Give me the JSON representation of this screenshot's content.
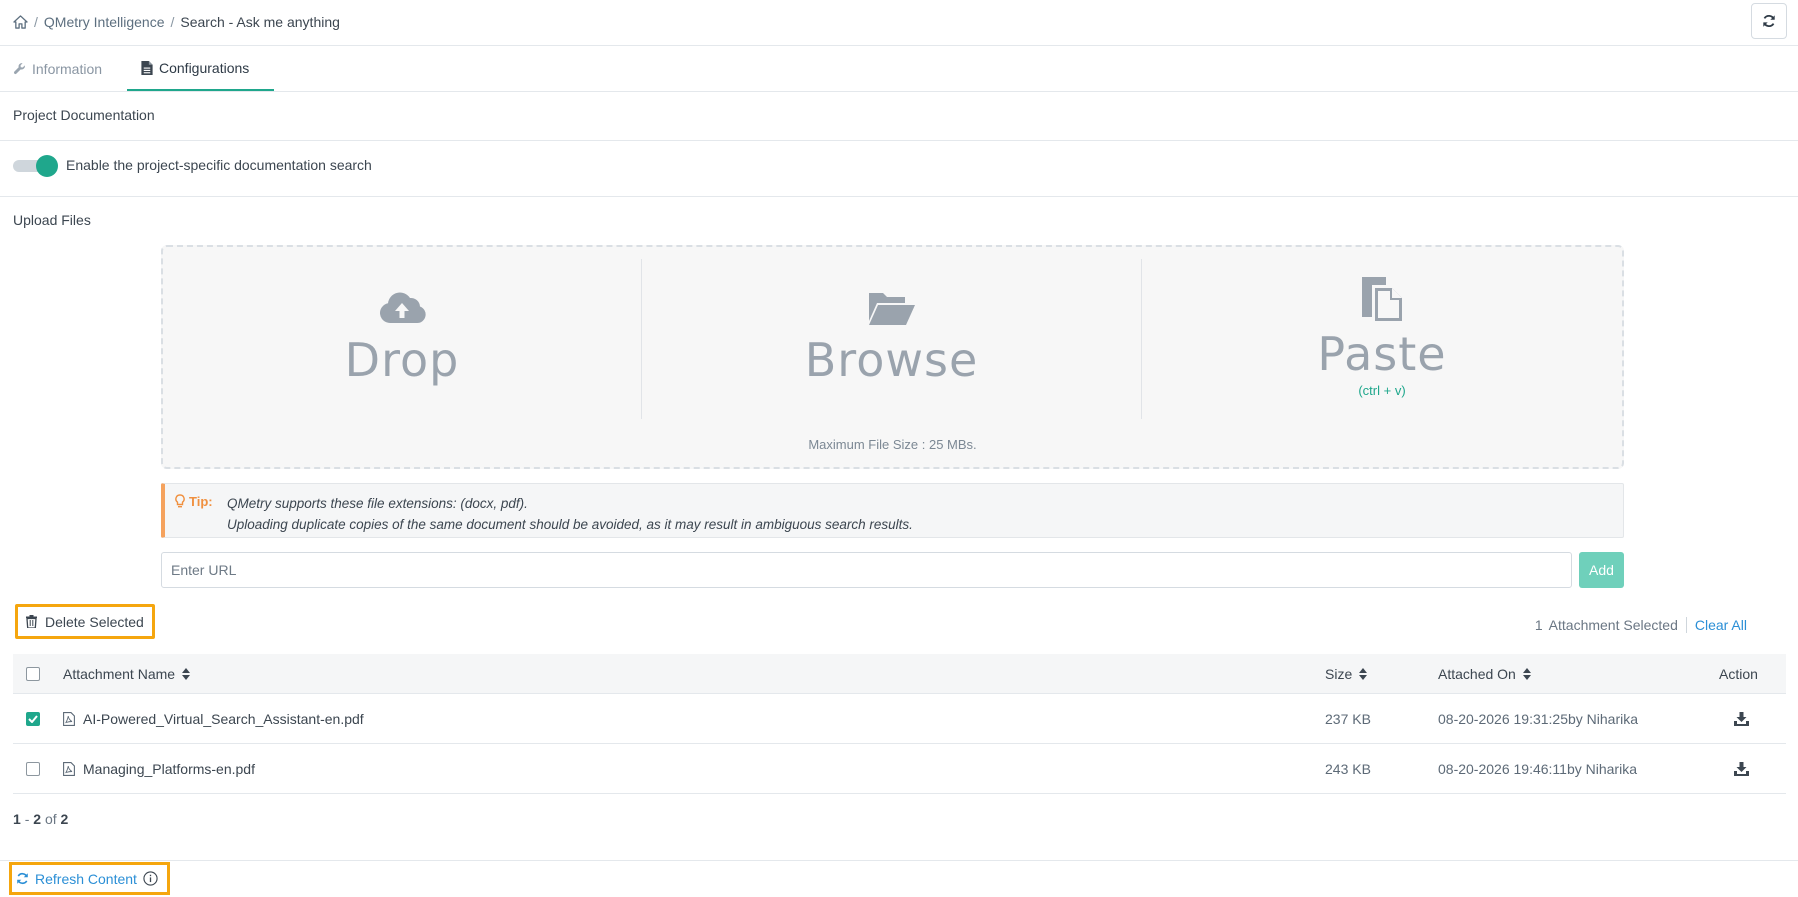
{
  "breadcrumb": {
    "home_icon": "home-icon",
    "items": [
      "QMetry Intelligence",
      "Search - Ask me anything"
    ],
    "separator": "/"
  },
  "header": {
    "refresh_icon": "refresh-icon"
  },
  "tabs": [
    {
      "label": "Information",
      "icon": "wrench-icon",
      "active": false
    },
    {
      "label": "Configurations",
      "icon": "document-icon",
      "active": true
    }
  ],
  "project_doc": {
    "title": "Project Documentation",
    "toggle_label": "Enable the project-specific documentation search",
    "toggle_on": true
  },
  "upload": {
    "title": "Upload Files",
    "drop_label": "Drop",
    "browse_label": "Browse",
    "paste_label": "Paste",
    "paste_hint": "(ctrl + v)",
    "max_size_note": "Maximum File Size : 25 MBs."
  },
  "tip": {
    "label": "Tip:",
    "line1": "QMetry supports these file extensions: (docx, pdf).",
    "line2": "Uploading duplicate copies of the same document should be avoided, as it may result in ambiguous search results."
  },
  "url_input": {
    "placeholder": "Enter URL",
    "value": ""
  },
  "add_label": "Add",
  "delete_selected_label": "Delete Selected",
  "selection": {
    "count": "1",
    "text": "Attachment Selected",
    "clear_all": "Clear All"
  },
  "table": {
    "columns": {
      "name": "Attachment Name",
      "size": "Size",
      "attached_on": "Attached On",
      "action": "Action"
    },
    "rows": [
      {
        "checked": true,
        "name": "AI-Powered_Virtual_Search_Assistant-en.pdf",
        "size": "237 KB",
        "attached_on": "08-20-2026 19:31:25by Niharika"
      },
      {
        "checked": false,
        "name": "Managing_Platforms-en.pdf",
        "size": "243 KB",
        "attached_on": "08-20-2026 19:46:11by Niharika"
      }
    ]
  },
  "pagination": {
    "start": "1",
    "dash": "-",
    "end": "2",
    "of": "of",
    "total": "2"
  },
  "refresh_content_label": "Refresh Content",
  "colors": {
    "accent": "#1fa78c",
    "highlight": "#f5a60e",
    "link": "#2b8fd6",
    "tip": "#f5a25d"
  }
}
